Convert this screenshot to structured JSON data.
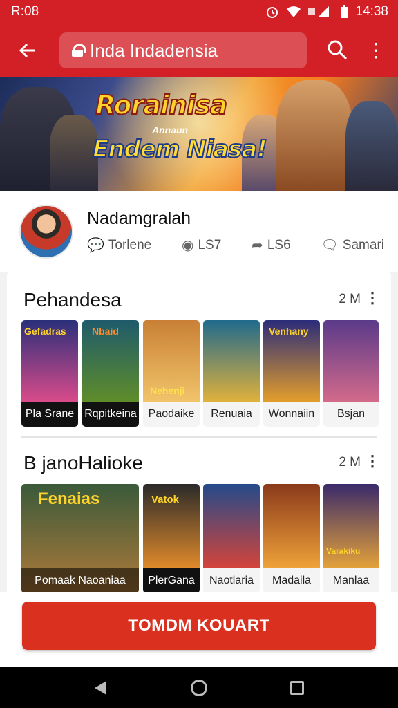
{
  "status_bar": {
    "time_left": "R:08",
    "time_right": "14:38",
    "icons": [
      "alarm-icon",
      "wifi-icon",
      "signal-icon",
      "battery-icon"
    ]
  },
  "app_bar": {
    "url_text": "Inda Indadensia",
    "icons": [
      "back-arrow-icon",
      "lock-icon",
      "search-icon",
      "more-vert-icon"
    ]
  },
  "banner": {
    "title_line1": "Rorainisa",
    "subtitle": "Annaun",
    "title_line2": "Endem Niasa!"
  },
  "profile": {
    "name": "Nadamgralah",
    "stats": [
      {
        "icon": "comment-icon",
        "label": "Torlene"
      },
      {
        "icon": "eye-icon",
        "label": "LS7"
      },
      {
        "icon": "share-icon",
        "label": "LS6"
      },
      {
        "icon": "chat-icon",
        "label": "Samari"
      }
    ]
  },
  "sections": [
    {
      "title": "Pehandesa",
      "count": "2 M",
      "tiles": [
        {
          "caption": "Pla Srane",
          "art_title": "Gefadras",
          "style": "dark",
          "color1": "#2a2f7a",
          "color2": "#d94b8a"
        },
        {
          "caption": "Rqpitkeina",
          "art_title": "Nbaid",
          "style": "dark",
          "color1": "#1e5a6b",
          "color2": "#5f8d2a"
        },
        {
          "caption": "Paodaike",
          "art_title": "Nehenji",
          "style": "light",
          "color1": "#c98036",
          "color2": "#f1c46a"
        },
        {
          "caption": "Renuaia",
          "art_title": "",
          "style": "light",
          "color1": "#1f6a8c",
          "color2": "#e0b13c"
        },
        {
          "caption": "Wonnaiin",
          "art_title": "Venhany",
          "style": "light",
          "color1": "#2b2b7a",
          "color2": "#e39e2b"
        },
        {
          "caption": "Bsjan",
          "art_title": "",
          "style": "light",
          "color1": "#5a3a8a",
          "color2": "#d36a8a"
        }
      ]
    },
    {
      "title": "B janoHalioke",
      "count": "2 M",
      "tiles": [
        {
          "caption": "Pomaak Naoaniaa",
          "art_title": "Fenaias",
          "style": "dark",
          "color1": "#3a5a3a",
          "color2": "#b07a3a"
        },
        {
          "caption": "PlerGana",
          "art_title": "Vatok",
          "style": "dark",
          "color1": "#2a2a2a",
          "color2": "#e08a2a"
        },
        {
          "caption": "Naotlaria",
          "art_title": "",
          "style": "light",
          "color1": "#244a8a",
          "color2": "#d4443a"
        },
        {
          "caption": "Madaila",
          "art_title": "",
          "style": "light",
          "color1": "#8a3a1a",
          "color2": "#f0a23a"
        },
        {
          "caption": "Manlaa",
          "art_title": "Varakiku",
          "style": "light",
          "color1": "#3a2a6a",
          "color2": "#e4a23a"
        }
      ]
    }
  ],
  "cta": {
    "label": "TOMDM KOUART"
  },
  "nav_bar": {
    "icons": [
      "back-icon",
      "home-icon",
      "recents-icon"
    ]
  },
  "colors": {
    "brand_red": "#d31f26",
    "cta_red": "#d9301f"
  }
}
